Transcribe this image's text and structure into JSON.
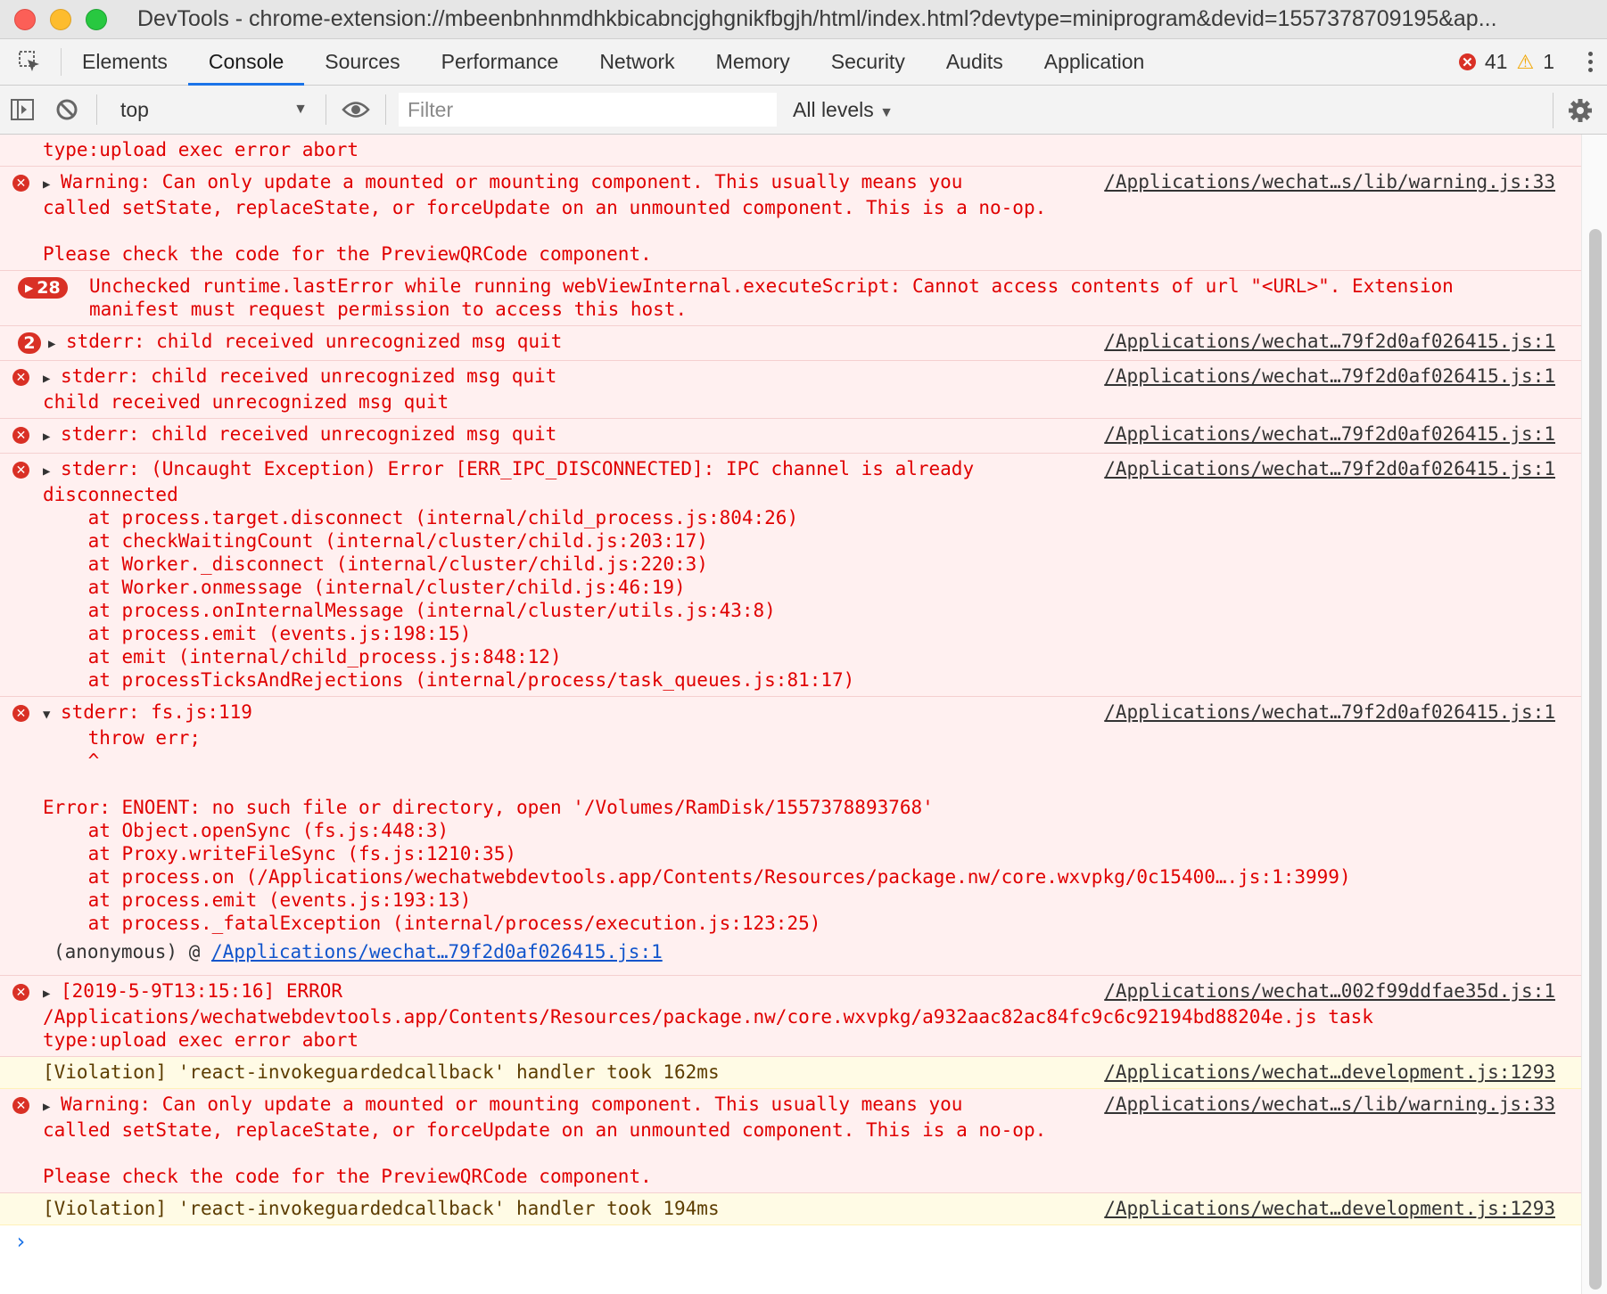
{
  "window": {
    "title": "DevTools - chrome-extension://mbeenbnhnmdhkbicabncjghgnikfbgjh/html/index.html?devtype=miniprogram&devid=1557378709195&ap..."
  },
  "tabs": [
    {
      "label": "Elements"
    },
    {
      "label": "Console",
      "active": true
    },
    {
      "label": "Sources"
    },
    {
      "label": "Performance"
    },
    {
      "label": "Network"
    },
    {
      "label": "Memory"
    },
    {
      "label": "Security"
    },
    {
      "label": "Audits"
    },
    {
      "label": "Application"
    }
  ],
  "counters": {
    "errors": "41",
    "warnings": "1"
  },
  "toolbar": {
    "context": "top",
    "filter_placeholder": "Filter",
    "filter_value": "",
    "levels": "All levels"
  },
  "messages": [
    {
      "type": "error",
      "icon": "none",
      "text": "type:upload exec error abort",
      "source": ""
    },
    {
      "type": "error",
      "icon": "error-icon",
      "expand": "collapsed",
      "text": "Warning: Can only update a mounted or mounting component. This usually means you\ncalled setState, replaceState, or forceUpdate on an unmounted component. This is a no-op.\n\nPlease check the code for the PreviewQRCode component.",
      "source": "/Applications/wechat…s/lib/warning.js:33"
    },
    {
      "type": "error",
      "icon": "count",
      "count": "28",
      "text": "Unchecked runtime.lastError while running webViewInternal.executeScript: Cannot access contents of url \"<URL>\". Extension\nmanifest must request permission to access this host.",
      "source": ""
    },
    {
      "type": "error",
      "icon": "count-round",
      "count": "2",
      "expand": "collapsed",
      "text": "stderr: child received unrecognized msg quit",
      "source": "/Applications/wechat…79f2d0af026415.js:1"
    },
    {
      "type": "error",
      "icon": "error-icon",
      "expand": "collapsed",
      "text": "stderr: child received unrecognized msg quit\nchild received unrecognized msg quit",
      "source": "/Applications/wechat…79f2d0af026415.js:1"
    },
    {
      "type": "error",
      "icon": "error-icon",
      "expand": "collapsed",
      "text": "stderr: child received unrecognized msg quit",
      "source": "/Applications/wechat…79f2d0af026415.js:1"
    },
    {
      "type": "error",
      "icon": "error-icon",
      "expand": "collapsed",
      "text": "stderr: (Uncaught Exception) Error [ERR_IPC_DISCONNECTED]: IPC channel is already\ndisconnected\n    at process.target.disconnect (internal/child_process.js:804:26)\n    at checkWaitingCount (internal/cluster/child.js:203:17)\n    at Worker._disconnect (internal/cluster/child.js:220:3)\n    at Worker.onmessage (internal/cluster/child.js:46:19)\n    at process.onInternalMessage (internal/cluster/utils.js:43:8)\n    at process.emit (events.js:198:15)\n    at emit (internal/child_process.js:848:12)\n    at processTicksAndRejections (internal/process/task_queues.js:81:17)",
      "source": "/Applications/wechat…79f2d0af026415.js:1"
    },
    {
      "type": "error",
      "icon": "error-icon",
      "expand": "expanded",
      "text": "stderr: fs.js:119\n    throw err;\n    ^\n\nError: ENOENT: no such file or directory, open '/Volumes/RamDisk/1557378893768'\n    at Object.openSync (fs.js:448:3)\n    at Proxy.writeFileSync (fs.js:1210:35)\n    at process.on (/Applications/wechatwebdevtools.app/Contents/Resources/package.nw/core.wxvpkg/0c15400….js:1:3999)\n    at process.emit (events.js:193:13)\n    at process._fatalException (internal/process/execution.js:123:25)",
      "source": "/Applications/wechat…79f2d0af026415.js:1",
      "anon_label": "(anonymous) @ ",
      "anon_link": "/Applications/wechat…79f2d0af026415.js:1"
    },
    {
      "type": "error",
      "icon": "error-icon",
      "expand": "collapsed",
      "text": "[2019-5-9T13:15:16] ERROR\n/Applications/wechatwebdevtools.app/Contents/Resources/package.nw/core.wxvpkg/a932aac82ac84fc9c6c92194bd88204e.js task\ntype:upload exec error abort",
      "source": "/Applications/wechat…002f99ddfae35d.js:1"
    },
    {
      "type": "warn",
      "icon": "none",
      "text": "[Violation] 'react-invokeguardedcallback' handler took 162ms",
      "source": "/Applications/wechat…development.js:1293"
    },
    {
      "type": "error",
      "icon": "error-icon",
      "expand": "collapsed",
      "text": "Warning: Can only update a mounted or mounting component. This usually means you\ncalled setState, replaceState, or forceUpdate on an unmounted component. This is a no-op.\n\nPlease check the code for the PreviewQRCode component.",
      "source": "/Applications/wechat…s/lib/warning.js:33"
    },
    {
      "type": "warn",
      "icon": "none",
      "text": "[Violation] 'react-invokeguardedcallback' handler took 194ms",
      "source": "/Applications/wechat…development.js:1293"
    }
  ],
  "prompt": "›"
}
